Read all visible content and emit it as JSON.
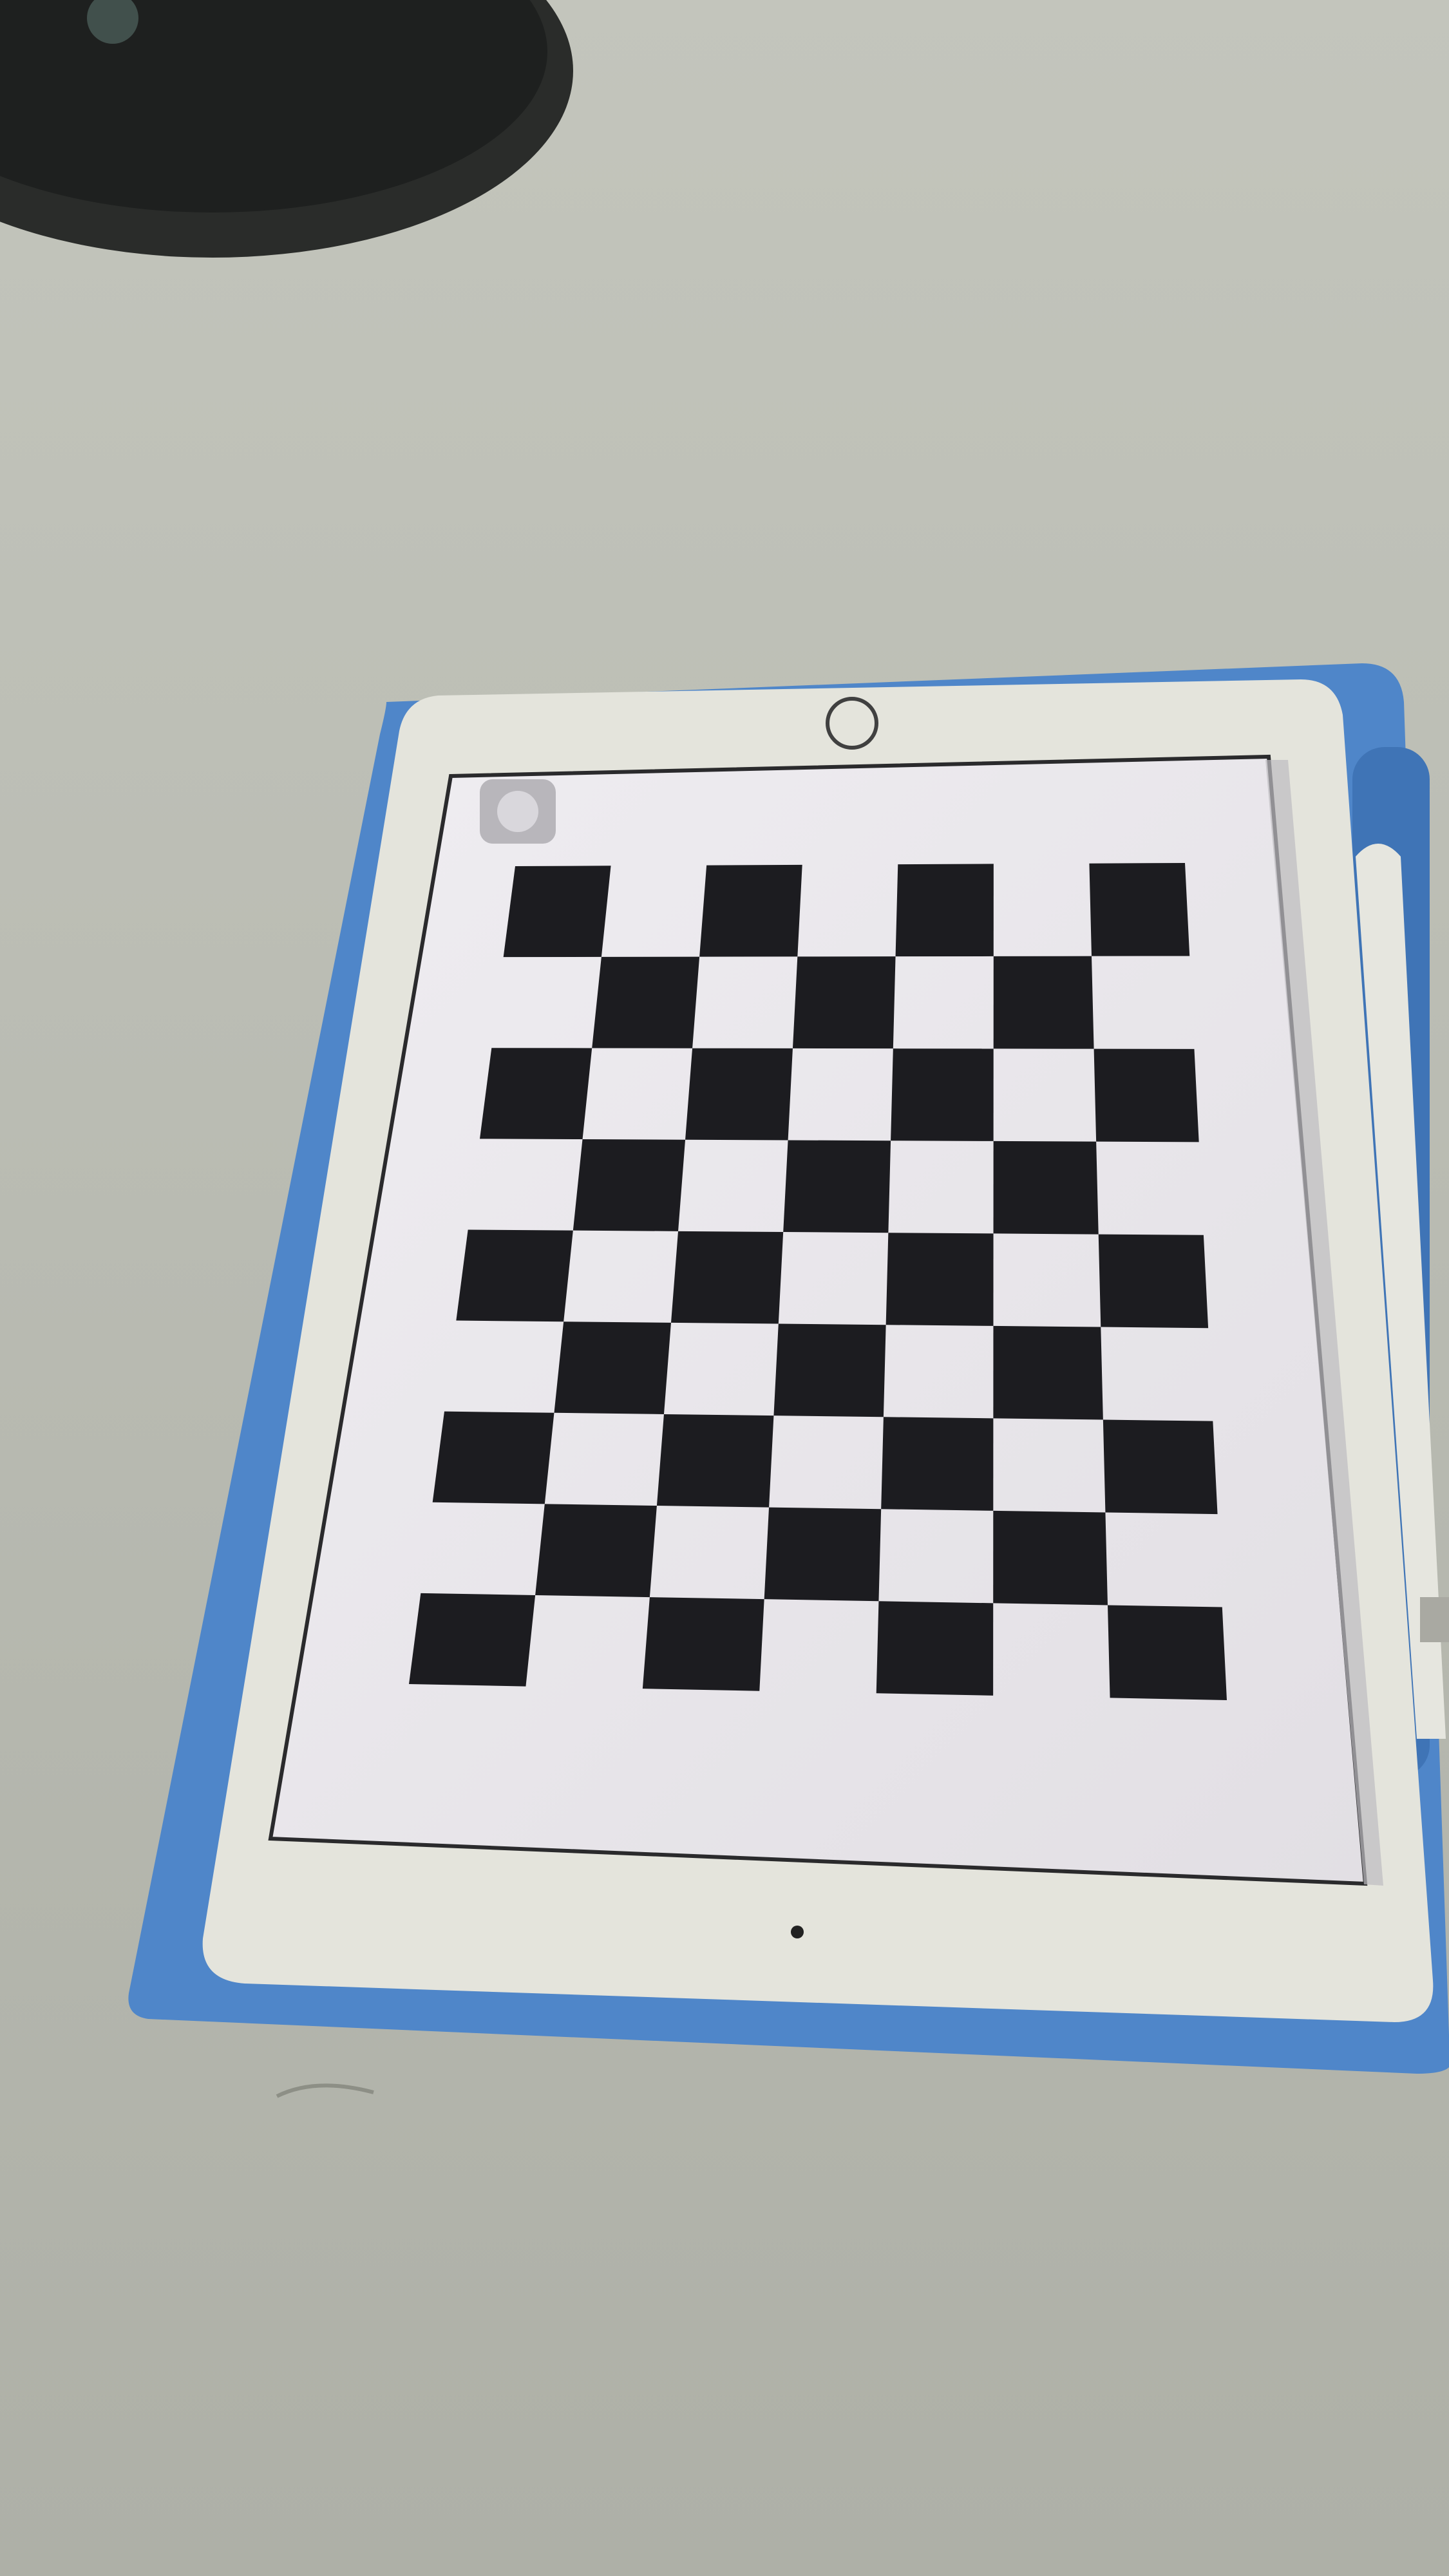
{
  "scene": {
    "background_color": "#bdbfb6",
    "subject": "tablet-displaying-checkerboard",
    "device": {
      "case_color": "#4f86c9",
      "bezel_color": "#e4e4dc",
      "screen_color": "#e9e6ea",
      "pencil_color": "#e6e6df",
      "home_button": "circle-outline"
    },
    "screen": {
      "pattern": "checkerboard",
      "rows": 9,
      "cols": 7,
      "dark_color": "#1c1c20",
      "light_color": "#ece9ee",
      "corner_icon": "assistive-touch-icon"
    },
    "objects": [
      {
        "name": "lamp-base",
        "color": "#2a2c2a"
      }
    ]
  }
}
